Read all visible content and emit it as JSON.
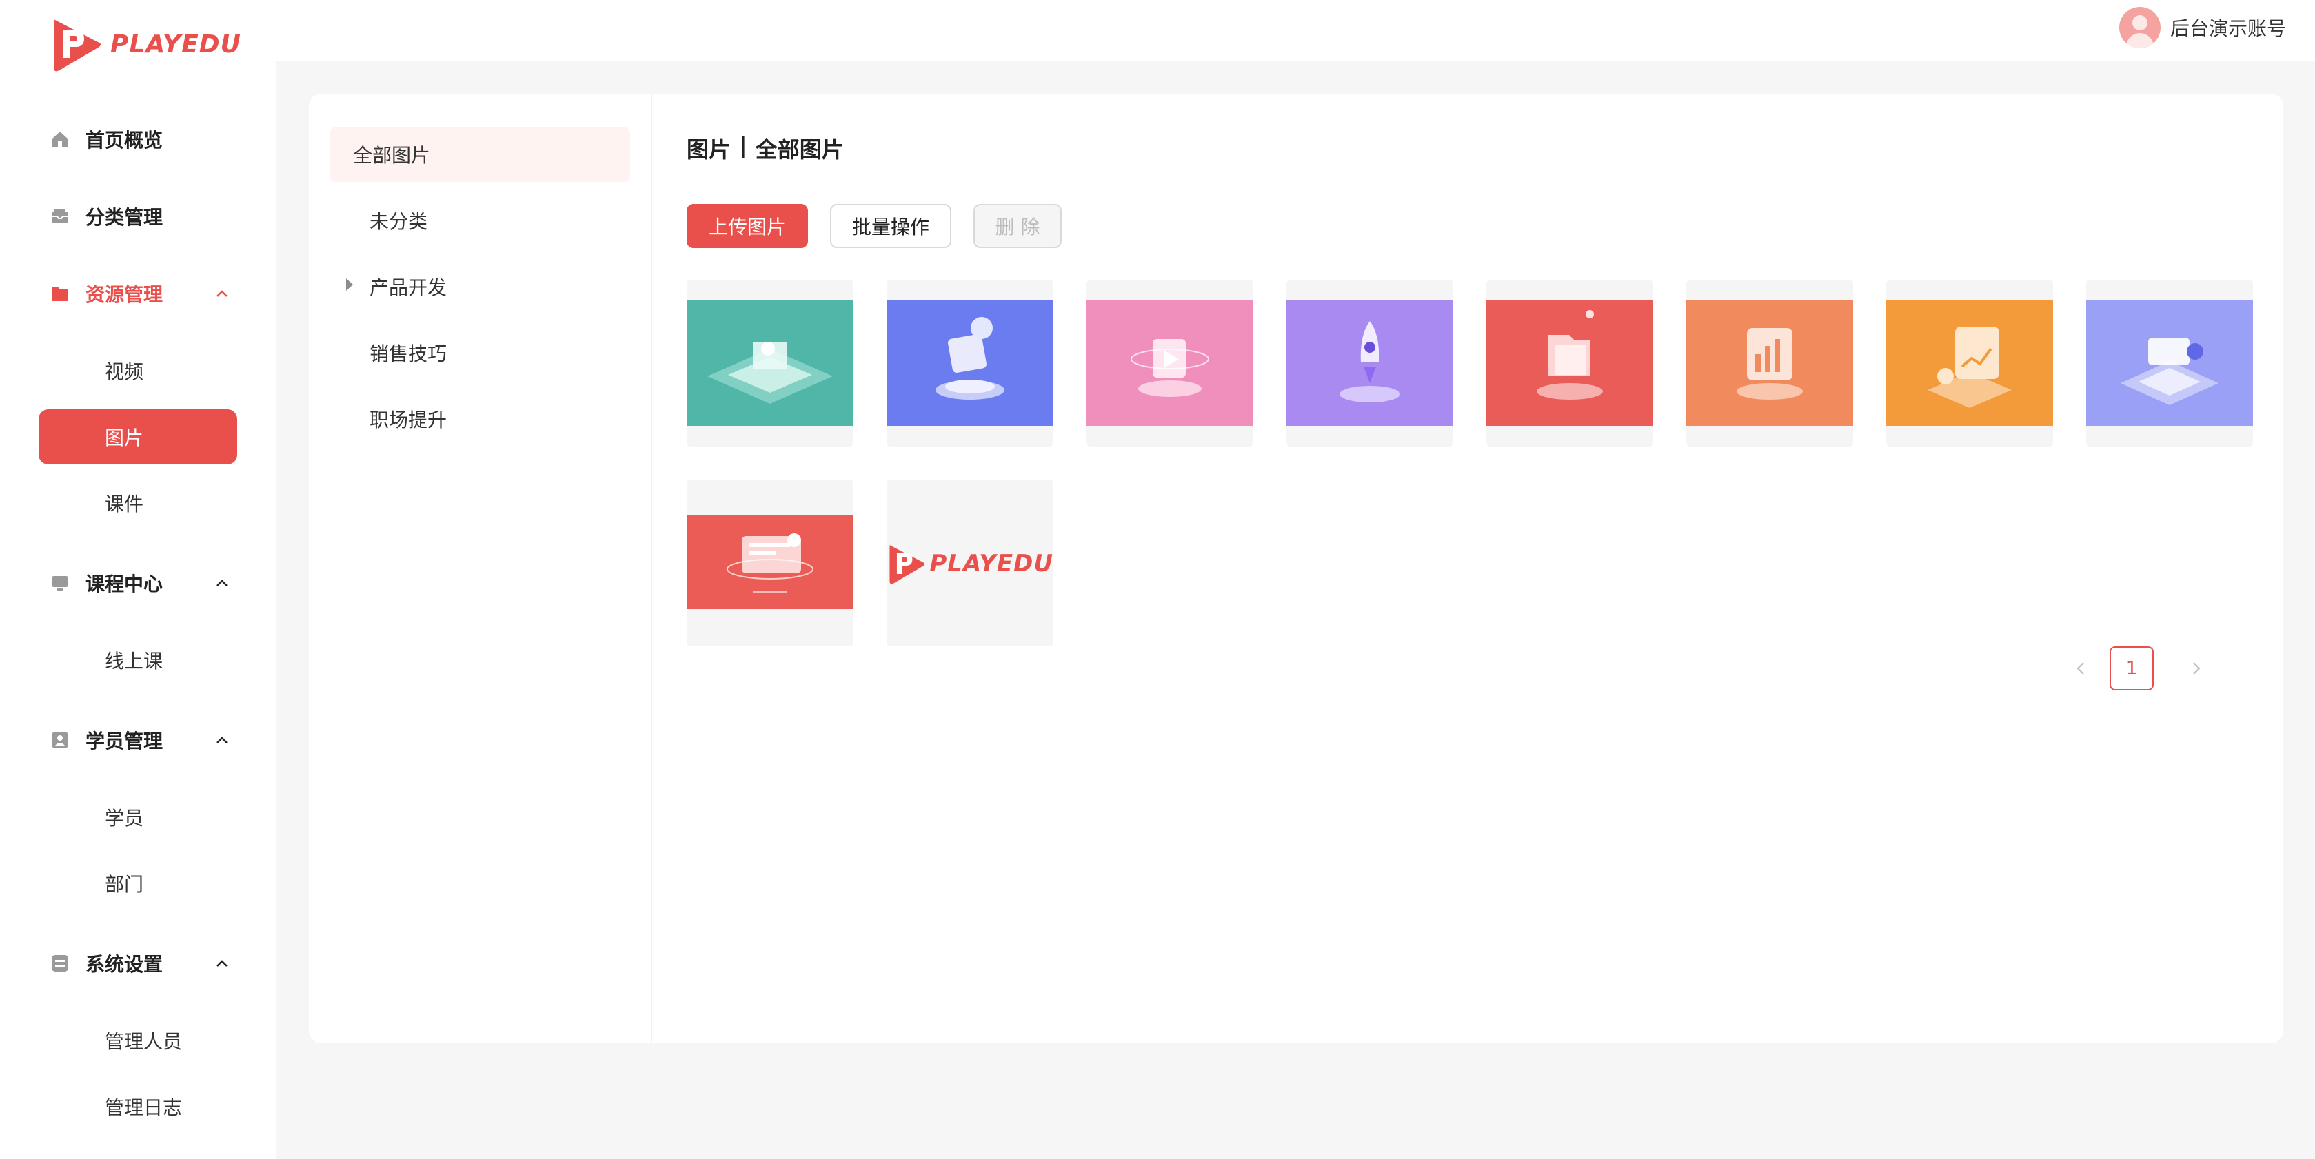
{
  "brand": {
    "logo_text": "PLAYEDU",
    "accent": "#e9504c"
  },
  "header": {
    "user_name": "后台演示账号"
  },
  "sidebar": {
    "items": [
      {
        "label": "首页概览",
        "icon": "home-icon"
      },
      {
        "label": "分类管理",
        "icon": "inbox-icon"
      },
      {
        "label": "资源管理",
        "icon": "folder-icon",
        "expanded": true,
        "active": true,
        "children": [
          "视频",
          "图片",
          "课件"
        ],
        "active_child": "图片"
      },
      {
        "label": "课程中心",
        "icon": "monitor-icon",
        "expanded": true,
        "children": [
          "线上课"
        ]
      },
      {
        "label": "学员管理",
        "icon": "user-card-icon",
        "expanded": true,
        "children": [
          "学员",
          "部门"
        ]
      },
      {
        "label": "系统设置",
        "icon": "settings-panel-icon",
        "expanded": true,
        "children": [
          "管理人员",
          "管理日志"
        ]
      }
    ]
  },
  "categories": {
    "items": [
      "全部图片",
      "未分类",
      "产品开发",
      "销售技巧",
      "职场提升"
    ],
    "active": "全部图片",
    "expandable": [
      "产品开发"
    ]
  },
  "content": {
    "breadcrumb_left": "图片",
    "breadcrumb_sep": "|",
    "breadcrumb_right": "全部图片",
    "buttons": {
      "upload": "上传图片",
      "batch": "批量操作",
      "delete": "删 除"
    },
    "images": [
      {
        "name": "thumb-teal",
        "color": "#4fb6a8"
      },
      {
        "name": "thumb-blue",
        "color": "#6b7cf0"
      },
      {
        "name": "thumb-pink",
        "color": "#f08fbb"
      },
      {
        "name": "thumb-purple",
        "color": "#a98af1"
      },
      {
        "name": "thumb-red",
        "color": "#ea5c58"
      },
      {
        "name": "thumb-orange",
        "color": "#f18a5c"
      },
      {
        "name": "thumb-amber",
        "color": "#f39b3a"
      },
      {
        "name": "thumb-lavender",
        "color": "#9aa0f6"
      },
      {
        "name": "thumb-red-ui",
        "color": "#ec5c57"
      },
      {
        "name": "thumb-logo",
        "color": "#f5f5f5"
      }
    ],
    "pagination": {
      "current": "1"
    }
  }
}
